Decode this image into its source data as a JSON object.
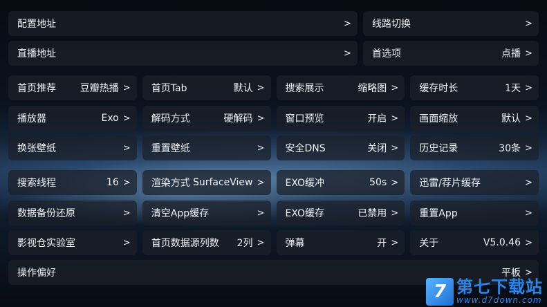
{
  "top_rows": [
    [
      {
        "label": "配置地址",
        "value": ""
      },
      {
        "label": "线路切换",
        "value": ""
      }
    ],
    [
      {
        "label": "直播地址",
        "value": ""
      },
      {
        "label": "首选项",
        "value": "点播"
      }
    ]
  ],
  "grid_rows": [
    [
      {
        "label": "首页推荐",
        "value": "豆瓣热播"
      },
      {
        "label": "首页Tab",
        "value": "默认"
      },
      {
        "label": "搜索展示",
        "value": "缩略图"
      },
      {
        "label": "缓存时长",
        "value": "1天"
      }
    ],
    [
      {
        "label": "播放器",
        "value": "Exo"
      },
      {
        "label": "解码方式",
        "value": "硬解码"
      },
      {
        "label": "窗口预览",
        "value": "开启"
      },
      {
        "label": "画面缩放",
        "value": "默认"
      }
    ],
    [
      {
        "label": "换张壁纸",
        "value": ""
      },
      {
        "label": "重置壁纸",
        "value": ""
      },
      {
        "label": "安全DNS",
        "value": "关闭"
      },
      {
        "label": "历史记录",
        "value": "30条"
      }
    ],
    [
      {
        "label": "搜索线程",
        "value": "16"
      },
      {
        "label": "渲染方式",
        "value": "SurfaceView"
      },
      {
        "label": "EXO缓冲",
        "value": "50s"
      },
      {
        "label": "迅雷/荐片缓存",
        "value": ""
      }
    ],
    [
      {
        "label": "数据备份还原",
        "value": ""
      },
      {
        "label": "清空App缓存",
        "value": ""
      },
      {
        "label": "EXO缓存",
        "value": "已禁用"
      },
      {
        "label": "重置App",
        "value": ""
      }
    ],
    [
      {
        "label": "影视仓实验室",
        "value": ""
      },
      {
        "label": "首页数据源列数",
        "value": "2列"
      },
      {
        "label": "弹幕",
        "value": "开"
      },
      {
        "label": "关于",
        "value": "V5.0.46"
      }
    ]
  ],
  "bottom_row": {
    "label": "操作偏好",
    "value": "平板"
  },
  "chevron": ">",
  "watermark": {
    "logo": "7",
    "main": "第七下载站",
    "sub": "www.d7down.com"
  }
}
